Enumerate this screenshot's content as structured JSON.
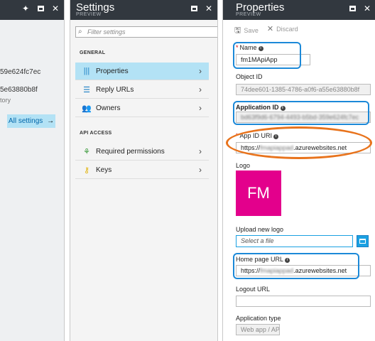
{
  "blade1": {
    "lines": [
      "59e624fc7ec",
      "5e63880b8f",
      "tory"
    ],
    "all_settings_label": "All settings",
    "all_settings_arrow": "→",
    "icons": [
      "pin-icon",
      "maximize-icon",
      "close-icon"
    ]
  },
  "blade2": {
    "title": "Settings",
    "subtitle": "PREVIEW",
    "filter_placeholder": "Filter settings",
    "sections": {
      "general": "GENERAL",
      "api_access": "API ACCESS"
    },
    "items": {
      "properties": "Properties",
      "reply_urls": "Reply URLs",
      "owners": "Owners",
      "required_permissions": "Required permissions",
      "keys": "Keys"
    }
  },
  "blade3": {
    "title": "Properties",
    "subtitle": "PREVIEW",
    "toolbar": {
      "save": "Save",
      "discard": "Discard"
    },
    "fields": {
      "name_label": "Name",
      "name_value": "fm1MApiApp",
      "object_id_label": "Object ID",
      "object_id_value": "74dee601-1385-4786-a0f6-a55e63880b8f",
      "application_id_label": "Application ID",
      "application_id_value": "bd63f9d6-6794-4493-b5bd-359e624fc7ec",
      "app_id_uri_label": "App ID URI",
      "app_id_uri_prefix": "https://",
      "app_id_uri_blur": "fmapiappad",
      "app_id_uri_suffix": ".azurewebsites.net",
      "logo_label": "Logo",
      "logo_initials": "FM",
      "upload_logo_label": "Upload new logo",
      "upload_placeholder": "Select a file",
      "home_page_label": "Home page URL",
      "home_page_prefix": "https://",
      "home_page_blur": "fmapiappad",
      "home_page_suffix": ".azurewebsites.net",
      "logout_url_label": "Logout URL",
      "logout_url_value": "",
      "app_type_label": "Application type",
      "app_type_value": "Web app / API"
    }
  },
  "colors": {
    "header": "#32383f",
    "selected": "#b3e2f5",
    "accent": "#1ba1e2",
    "logo": "#e3008c",
    "highlight_blue": "#1c89d8",
    "highlight_orange": "#e8731c"
  }
}
